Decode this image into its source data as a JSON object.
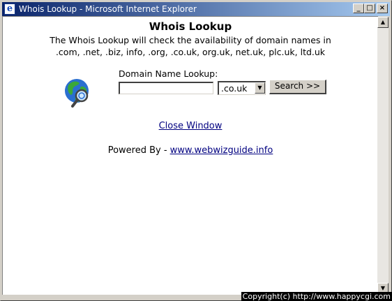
{
  "window": {
    "title": "Whois Lookup - Microsoft Internet Explorer",
    "minimize": "_",
    "maximize": "□",
    "close": "×"
  },
  "page": {
    "heading": "Whois Lookup",
    "description_line1": "The Whois Lookup will check the availability of domain names in",
    "description_line2": ".com, .net, .biz, info, .org, .co.uk, org.uk, net.uk, plc.uk, ltd.uk",
    "lookup_label": "Domain Name Lookup:",
    "domain_value": "",
    "tld_selected": ".co.uk",
    "search_label": "Search >>",
    "close_link": "Close Window",
    "powered_by": "Powered By - ",
    "powered_link": "www.webwizguide.info"
  },
  "scrollbar": {
    "up_arrow": "▲",
    "down_arrow": "▼"
  },
  "overlay": {
    "copyright": "Copyright(c) http://www.happycgi.com"
  },
  "icons": {
    "globe": "globe-magnifier-icon",
    "ie": "ie-icon"
  },
  "colors": {
    "title_start": "#0a246a",
    "title_end": "#a6caf0",
    "link": "#000080"
  }
}
